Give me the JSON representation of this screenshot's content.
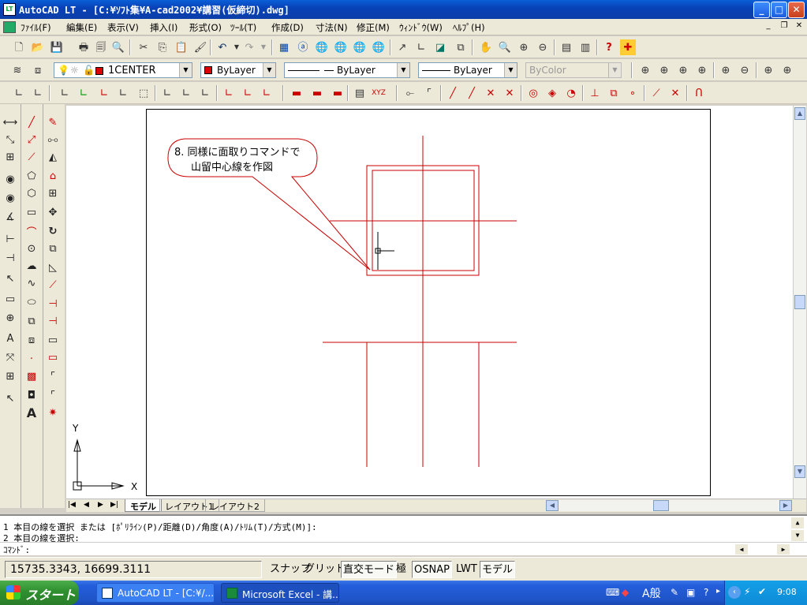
{
  "window": {
    "app_icon_text": "LT",
    "title": "AutoCAD LT - [C:¥ｿﾌﾄ集¥A-cad2002¥講習(仮締切).dwg]"
  },
  "menu": {
    "items": [
      "ﾌｧｲﾙ(F)",
      "編集(E)",
      "表示(V)",
      "挿入(I)",
      "形式(O)",
      "ﾂｰﾙ(T)",
      "作成(D)",
      "寸法(N)",
      "修正(M)",
      "ｳｨﾝﾄﾞｳ(W)",
      "ﾍﾙﾌﾟ(H)"
    ]
  },
  "layers": {
    "layer_name": "1CENTER",
    "color": "ByLayer",
    "linetype": "ByLayer",
    "lineweight": "ByLayer",
    "plotstyle": "ByColor"
  },
  "drawing": {
    "callout_line1": "8. 同様に面取りコマンドで",
    "callout_line2": "山留中心線を作図",
    "ucs_x": "X",
    "ucs_y": "Y",
    "line_color": "#cc0000"
  },
  "tabs": {
    "model": "モデル",
    "layout1": "レイアウト1",
    "layout2": "レイアウト2"
  },
  "command": {
    "line1": "1 本目の線を選択 または [ﾎﾟﾘﾗｲﾝ(P)/距離(D)/角度(A)/ﾄﾘﾑ(T)/方式(M)]:",
    "line2": "2 本目の線を選択:",
    "prompt": "ｺﾏﾝﾄﾞ:"
  },
  "status": {
    "coords": "15735.3343, 16699.3111",
    "snap": "スナップ",
    "grid": "グリッド",
    "ortho": "直交モード",
    "polar": "極",
    "osnap": "OSNAP",
    "lwt": "LWT",
    "model": "モデル"
  },
  "taskbar": {
    "start": "スタート",
    "item1": "AutoCAD LT - [C:¥/...",
    "item2": "Microsoft Excel - 講...",
    "ime": "A般",
    "clock": "9:08"
  }
}
